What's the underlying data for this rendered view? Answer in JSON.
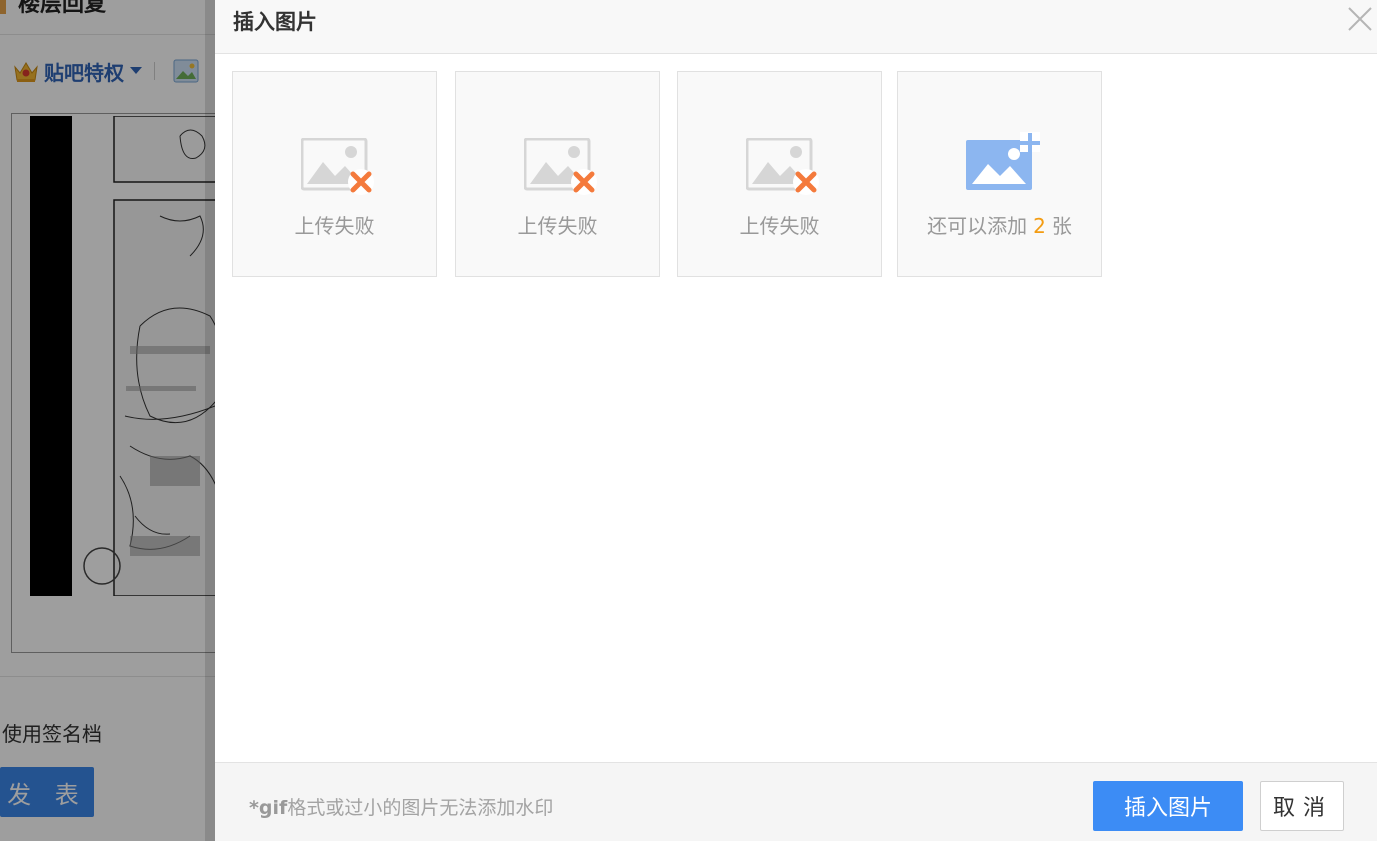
{
  "background_page": {
    "title": "楼层回复",
    "privilege_label": "贴吧特权",
    "signature_label": "使用签名档",
    "publish_label": "发 表"
  },
  "dialog": {
    "title": "插入图片",
    "tiles": [
      {
        "status": "上传失败"
      },
      {
        "status": "上传失败"
      },
      {
        "status": "上传失败"
      }
    ],
    "add_tile": {
      "prefix": "还可以添加",
      "count": "2",
      "suffix": "张"
    },
    "footer": {
      "note_prefix": "*gif",
      "note_text": "格式或过小的图片无法添加水印",
      "insert_label": "插入图片",
      "cancel_label": "取消"
    }
  },
  "colors": {
    "accent": "#3c8cf5",
    "error": "#f47a3c",
    "count": "#f39c12",
    "add_icon": "#8cb6f0"
  }
}
